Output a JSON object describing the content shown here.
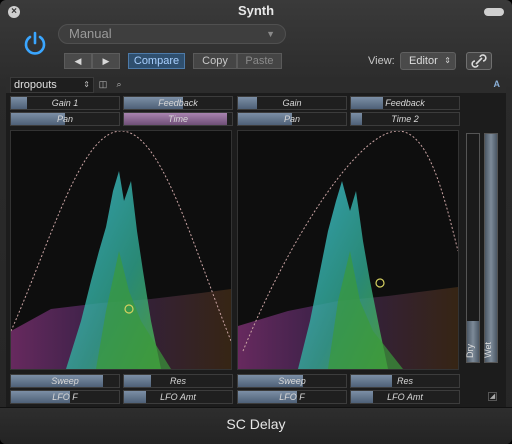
{
  "window": {
    "title": "Synth"
  },
  "header": {
    "preset": "Manual",
    "nav_prev": "◀",
    "nav_next": "▶",
    "compare": "Compare",
    "copy": "Copy",
    "paste": "Paste",
    "view_label": "View:",
    "view_value": "Editor"
  },
  "plugin_bar": {
    "preset_menu": "dropouts",
    "auto_label": "A"
  },
  "left": {
    "top_buttons": [
      {
        "label": "Gain 1",
        "level": 0.15,
        "color": "blue"
      },
      {
        "label": "Feedback",
        "level": 0.55,
        "color": "blue"
      },
      {
        "label": "Pan",
        "level": 0.5,
        "color": "blue"
      },
      {
        "label": "Time",
        "level": 0.95,
        "color": "pink"
      }
    ],
    "bottom_buttons": [
      {
        "label": "Sweep",
        "level": 0.85
      },
      {
        "label": "Res",
        "level": 0.25
      },
      {
        "label": "LFO F",
        "level": 0.55
      },
      {
        "label": "LFO Amt",
        "level": 0.2
      }
    ]
  },
  "right": {
    "top_buttons": [
      {
        "label": "Gain",
        "level": 0.18,
        "color": "blue"
      },
      {
        "label": "Feedback",
        "level": 0.3,
        "color": "blue"
      },
      {
        "label": "Pan",
        "level": 0.5,
        "color": "blue"
      },
      {
        "label": "Time 2",
        "level": 0.1,
        "color": "blue"
      }
    ],
    "bottom_buttons": [
      {
        "label": "Sweep",
        "level": 0.6
      },
      {
        "label": "Res",
        "level": 0.38
      },
      {
        "label": "LFO F",
        "level": 0.55
      },
      {
        "label": "LFO Amt",
        "level": 0.2
      }
    ]
  },
  "mix": {
    "dry_label": "Dry",
    "dry_level": 0.18,
    "wet_label": "Wet",
    "wet_level": 1.0
  },
  "footer": {
    "plugin_name": "SC Delay"
  },
  "colors": {
    "accent": "#2f4f6e",
    "spectrum_pink": "#b040a0",
    "spectrum_cyan": "#40c8e0",
    "spectrum_green": "#40b840"
  }
}
